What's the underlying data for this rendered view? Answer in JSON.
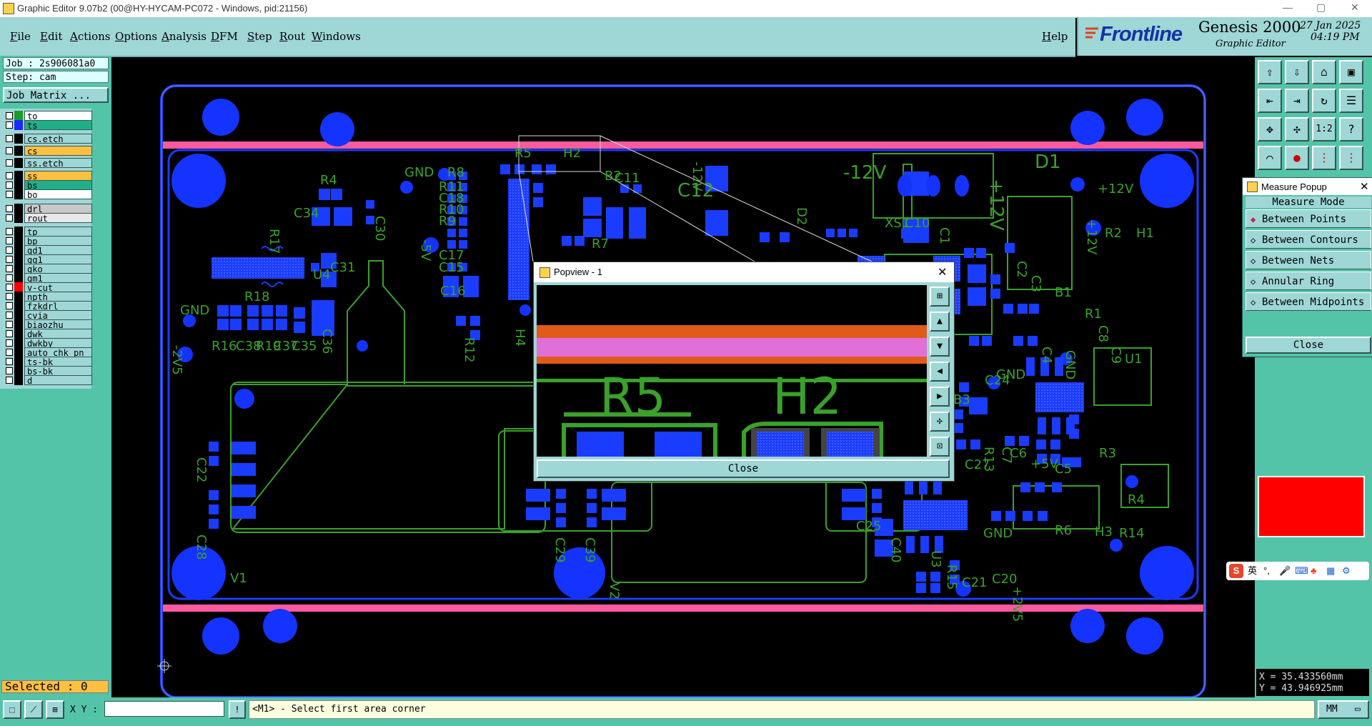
{
  "window": {
    "title": "Graphic Editor 9.07b2 (00@HY-HYCAM-PC072 - Windows, pid:21156)",
    "min": "—",
    "max": "▢",
    "close": "✕"
  },
  "menu": [
    {
      "label": "File"
    },
    {
      "label": "Edit"
    },
    {
      "label": "Actions"
    },
    {
      "label": "Options"
    },
    {
      "label": "Analysis"
    },
    {
      "label": "DFM"
    },
    {
      "label": "Step"
    },
    {
      "label": "Rout"
    },
    {
      "label": "Windows"
    }
  ],
  "help": "Help",
  "brand": {
    "logo": "Frontline",
    "product": "Genesis 2000",
    "subtitle": "Graphic Editor",
    "date": "27 Jan 2025",
    "time": "04:19 PM"
  },
  "job": {
    "job_line": "Job : 2s906081a0",
    "step_line": "Step: cam",
    "matrix_button": "Job Matrix ..."
  },
  "layers": [
    {
      "name": "to",
      "color": "#1a9d2a",
      "bg": "#ffffff"
    },
    {
      "name": "ts",
      "color": "#1a2aff",
      "bg": "#1fb08a"
    },
    {
      "name": "cs.etch",
      "color": "#000000",
      "bg": "#9fd6d6"
    },
    {
      "name": "cs",
      "color": "#000000",
      "bg": "#ffc040"
    },
    {
      "name": "ss.etch",
      "color": "#000000",
      "bg": "#9fd6d6"
    },
    {
      "name": "ss",
      "color": "#000000",
      "bg": "#ffc040"
    },
    {
      "name": "bs",
      "color": "#000000",
      "bg": "#1fb08a"
    },
    {
      "name": "bo",
      "color": "#000000",
      "bg": "#ffffff"
    },
    {
      "name": "drl",
      "color": "#000000",
      "bg": "#c8c8c8"
    },
    {
      "name": "rout",
      "color": "#000000",
      "bg": "#e8e8e8"
    },
    {
      "name": "tp",
      "color": "#000000",
      "bg": "#9fd6d6"
    },
    {
      "name": "bp",
      "color": "#000000",
      "bg": "#9fd6d6"
    },
    {
      "name": "gd1",
      "color": "#000000",
      "bg": "#9fd6d6"
    },
    {
      "name": "gg1",
      "color": "#000000",
      "bg": "#9fd6d6"
    },
    {
      "name": "gko",
      "color": "#000000",
      "bg": "#9fd6d6"
    },
    {
      "name": "gm1",
      "color": "#000000",
      "bg": "#9fd6d6"
    },
    {
      "name": "v-cut",
      "color": "#ff0000",
      "bg": "#9fd6d6"
    },
    {
      "name": "npth",
      "color": "#000000",
      "bg": "#9fd6d6"
    },
    {
      "name": "fzkdrl",
      "color": "#000000",
      "bg": "#9fd6d6"
    },
    {
      "name": "cvia",
      "color": "#000000",
      "bg": "#9fd6d6"
    },
    {
      "name": "biaozhu",
      "color": "#000000",
      "bg": "#9fd6d6"
    },
    {
      "name": "dwk",
      "color": "#000000",
      "bg": "#9fd6d6"
    },
    {
      "name": "dwkby",
      "color": "#000000",
      "bg": "#9fd6d6"
    },
    {
      "name": "auto_chk_pn",
      "color": "#000000",
      "bg": "#9fd6d6"
    },
    {
      "name": "ts-bk",
      "color": "#000000",
      "bg": "#9fd6d6"
    },
    {
      "name": "bs-bk",
      "color": "#000000",
      "bg": "#9fd6d6"
    },
    {
      "name": "d",
      "color": "#000000",
      "bg": "#9fd6d6"
    }
  ],
  "selected": "Selected : 0",
  "pcb_labels": [
    "GND",
    "R8",
    "R11",
    "C18",
    "R10",
    "R9",
    "C17",
    "C15",
    "C16",
    "R5",
    "H2",
    "B2",
    "C11",
    "-12V",
    "C12",
    "D2",
    "-12V",
    "XS1",
    "C10",
    "C1",
    "+12V",
    "D1",
    "+12V",
    "+12V",
    "R2",
    "H1",
    "R4",
    "C34",
    "R17",
    "C30",
    "U4",
    "C31",
    "-5V",
    "R7",
    "GND",
    "R18",
    "R16",
    "C38",
    "R19",
    "C37",
    "C35",
    "C36",
    "-2V5",
    "R12",
    "H4",
    "C2",
    "C3",
    "B1",
    "R1",
    "C8",
    "C9",
    "U1",
    "GND",
    "C4",
    "GND",
    "C24",
    "B3",
    "C26",
    "C7",
    "R13",
    "C19",
    "C27",
    "C6",
    "R3",
    "+5V",
    "C5",
    "R4",
    "C22",
    "C28",
    "V1",
    "C29",
    "C39",
    "V2",
    "C40",
    "C25",
    "U3",
    "GND",
    "R6",
    "H3",
    "R14",
    "R15",
    "+2V5",
    "C21",
    "C20"
  ],
  "measure": {
    "title": "Measure Popup",
    "mode_label": "Measure Mode",
    "options": [
      "Between Points",
      "Between Contours",
      "Between Nets",
      "Annular Ring",
      "Between Midpoints"
    ],
    "close": "Close"
  },
  "popview": {
    "title": "Popview - 1",
    "close": "Close",
    "labels": [
      "R5",
      "H2"
    ]
  },
  "coords": {
    "x": "X = 35.433560mm",
    "y": "Y = 43.946925mm"
  },
  "status": {
    "xy_label": "X Y :",
    "message": "<M1> - Select first area corner",
    "units": "MM"
  },
  "ime": {
    "lang": "英",
    "punct": "°,"
  }
}
